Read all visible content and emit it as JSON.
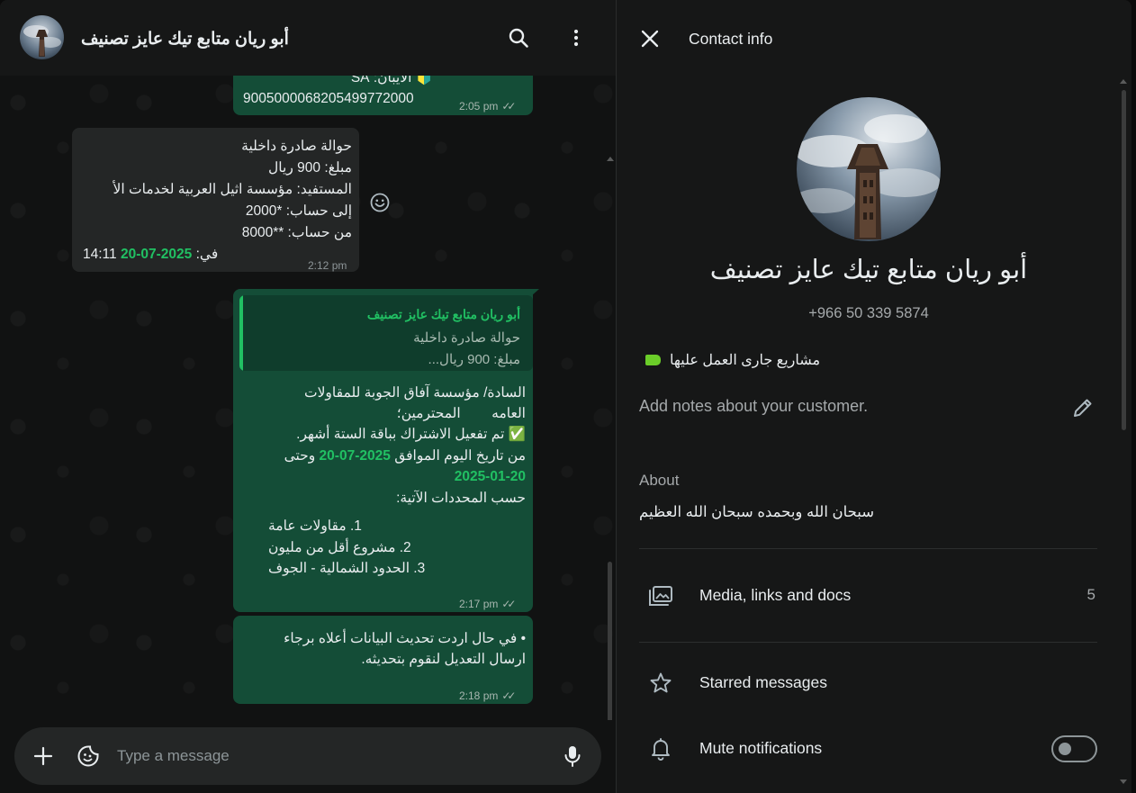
{
  "chat": {
    "title": "أبو ريان متابع تيك عايز تصنيف",
    "icons": {
      "search": "search-icon",
      "menu": "vertical-dots-icon"
    }
  },
  "messages": [
    {
      "direction": "out",
      "lines": [
        "🔰 الايبان: SA",
        "9005000068205499772000"
      ],
      "time": "2:05 pm",
      "status": "read"
    },
    {
      "direction": "in",
      "lines": [
        "حوالة صادرة داخلية",
        "مبلغ: 900 ريال",
        "المستفيد: مؤسسة اثيل العربية لخدمات الأ",
        "إلى حساب: *2000",
        "من حساب: **8000"
      ],
      "date_prefix": "في:",
      "date": "2025-07-20",
      "date_time": "14:11",
      "time": "2:12 pm"
    },
    {
      "direction": "out",
      "quote": {
        "author": "أبو ريان متابع تيك عايز تصنيف",
        "line1": "حوالة صادرة داخلية",
        "line2": "مبلغ: 900 ريال..."
      },
      "greeting_1": "السادة/  مؤسسة آفاق الجوبة للمقاولات",
      "greeting_2": "العامه        المحترمين؛",
      "activation": "✅ تم تفعيل الاشتراك بباقة الستة أشهر.",
      "from_prefix": "من تاريخ اليوم الموافق",
      "from_date": "2025-07-20",
      "and_until": "وحتى",
      "to_date": "2025-01-20",
      "criteria_title": "حسب المحددات الآتية:",
      "criteria": [
        "1. مقاولات عامة",
        "2. مشروع أقل من مليون",
        "3. الحدود الشمالية - الجوف"
      ],
      "time": "2:17 pm",
      "status": "read"
    },
    {
      "direction": "out",
      "lines": [
        "• في حال اردت تحديث البيانات أعلاه برجاء",
        "ارسال التعديل لنقوم بتحديثه."
      ],
      "time": "2:18 pm",
      "status": "read"
    }
  ],
  "composer": {
    "placeholder": "Type a message",
    "icons": {
      "attach": "plus-icon",
      "sticker": "sticker-icon",
      "voice": "microphone-icon"
    }
  },
  "contact_info": {
    "title": "Contact info",
    "name": "أبو ريان متابع تيك عايز تصنيف",
    "phone": "+966 50 339 5874",
    "label": {
      "text": "مشاريع جارى العمل عليها",
      "color": "#6bcd29"
    },
    "notes_placeholder": "Add notes about your customer.",
    "about_label": "About",
    "about_text": "سبحان الله وبحمده سبحان الله العظيم",
    "rows": {
      "media": {
        "label": "Media, links and docs",
        "count": "5"
      },
      "starred": {
        "label": "Starred messages"
      },
      "mute": {
        "label": "Mute notifications",
        "enabled": false
      }
    }
  },
  "colors": {
    "accent": "#21c063",
    "outgoing_bubble": "#144d37",
    "incoming_bubble": "#242626",
    "background": "#111212"
  }
}
